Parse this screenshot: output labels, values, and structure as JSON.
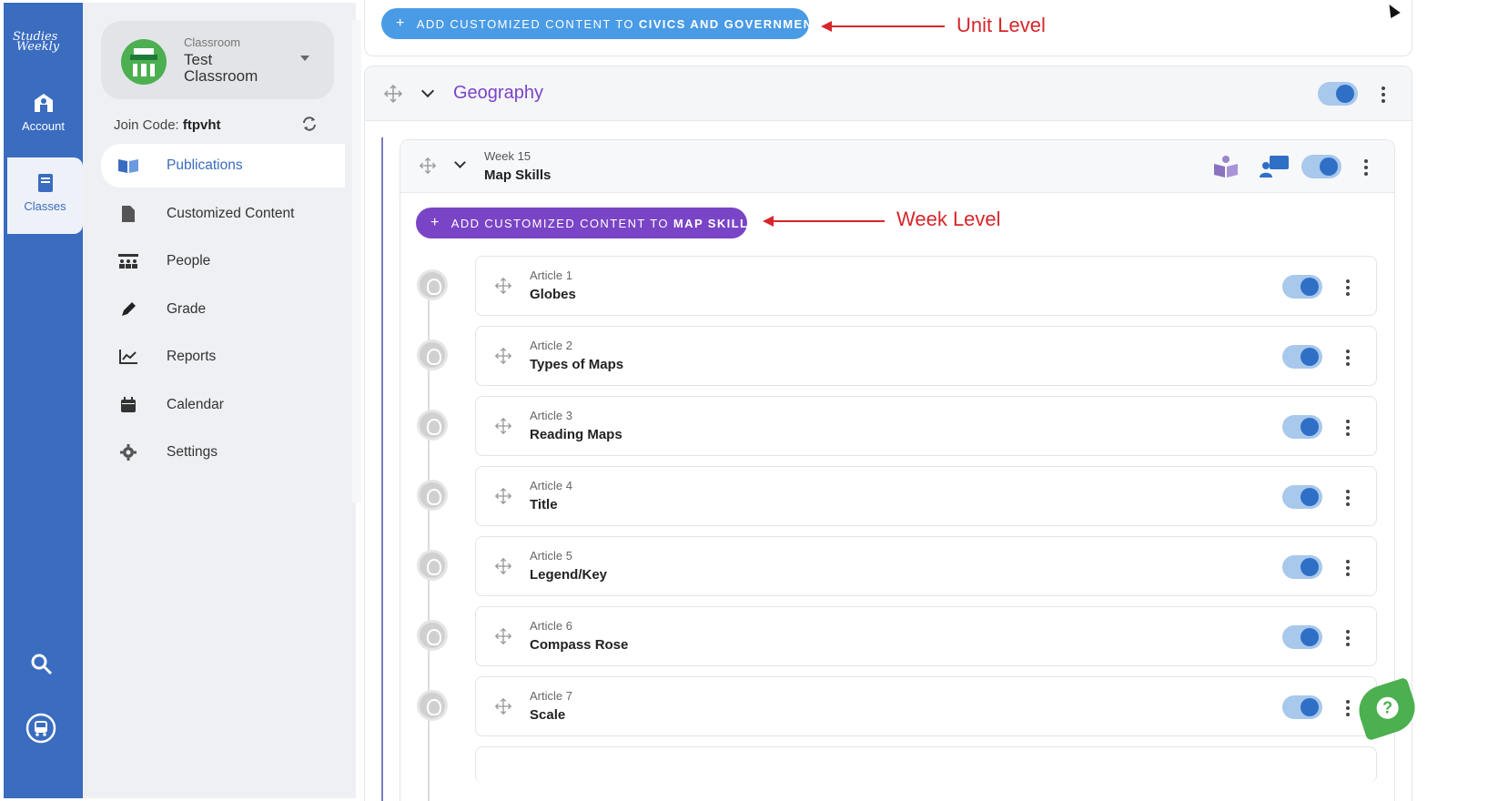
{
  "brand": {
    "logo_line1": "Studies",
    "logo_line2": "Weekly"
  },
  "rail": {
    "items": [
      {
        "label": "Account",
        "icon": "account-icon"
      },
      {
        "label": "Classes",
        "icon": "book-icon"
      }
    ],
    "bottom_icons": [
      "search-icon",
      "bus-icon"
    ]
  },
  "classroom": {
    "label": "Classroom",
    "name": "Test Classroom",
    "join_label": "Join Code:",
    "join_code": "ftpvht"
  },
  "nav": [
    {
      "label": "Publications",
      "icon": "book-open-icon",
      "active": true
    },
    {
      "label": "Customized Content",
      "icon": "document-icon"
    },
    {
      "label": "People",
      "icon": "people-icon"
    },
    {
      "label": "Grade",
      "icon": "pencil-icon"
    },
    {
      "label": "Reports",
      "icon": "chart-icon"
    },
    {
      "label": "Calendar",
      "icon": "calendar-icon"
    },
    {
      "label": "Settings",
      "icon": "gear-icon"
    }
  ],
  "unit": {
    "add_prefix": "ADD CUSTOMIZED CONTENT TO",
    "add_target": "CIVICS AND GOVERNMENT",
    "annotation": "Unit Level",
    "title": "Geography"
  },
  "week": {
    "label": "Week 15",
    "title": "Map Skills",
    "add_prefix": "ADD CUSTOMIZED CONTENT TO",
    "add_target": "MAP SKILLS",
    "annotation": "Week Level"
  },
  "articles": [
    {
      "num": "Article 1",
      "title": "Globes"
    },
    {
      "num": "Article 2",
      "title": "Types of Maps"
    },
    {
      "num": "Article 3",
      "title": "Reading Maps"
    },
    {
      "num": "Article 4",
      "title": "Title"
    },
    {
      "num": "Article 5",
      "title": "Legend/Key"
    },
    {
      "num": "Article 6",
      "title": "Compass Rose"
    },
    {
      "num": "Article 7",
      "title": "Scale"
    }
  ],
  "colors": {
    "rail": "#3a6cbf",
    "accent_purple": "#7a44c6",
    "accent_blue": "#4a9be6",
    "annotation_red": "#d6262a",
    "help_green": "#4caf50"
  },
  "help": {
    "label": "?"
  }
}
